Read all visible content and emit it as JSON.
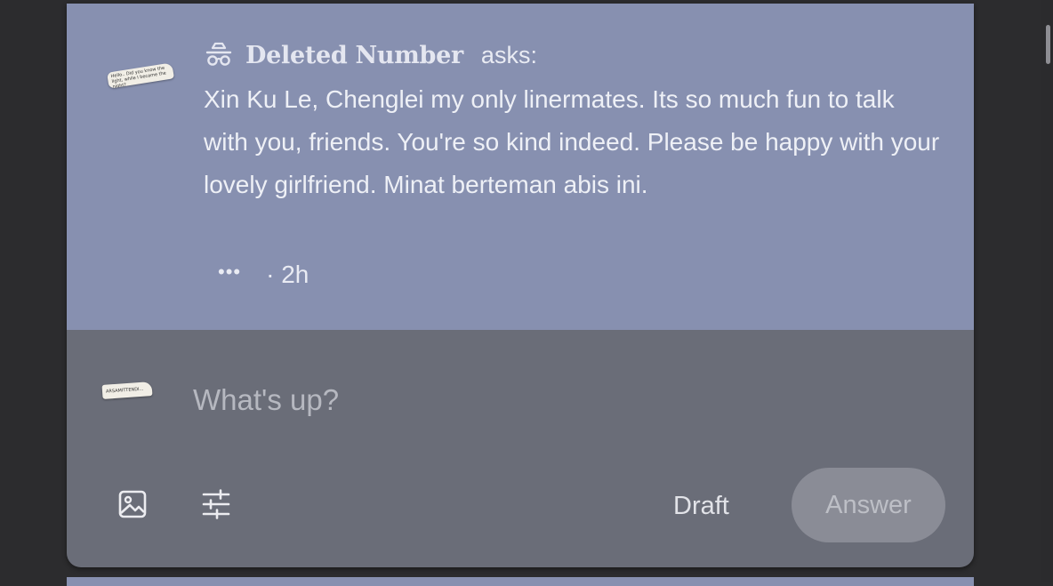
{
  "question": {
    "asker_name": "Deleted Number",
    "asks_label": "asks:",
    "asker_icon": "incognito-icon",
    "asker_avatar_text": "Hello.. Did you know the light, while I became the night?",
    "text": "Xin Ku Le, Chenglei my only linermates. Its so much fun to talk with you, friends. You're so kind indeed. Please be happy with your lovely girlfriend. Minat berteman abis ini.",
    "more_label": "•••",
    "time": "· 2h"
  },
  "answer_box": {
    "avatar_text": "ARSAMITTENDI...",
    "placeholder": "What's up?",
    "value": "",
    "image_icon": "image-icon",
    "settings_icon": "sliders-icon",
    "draft_label": "Draft",
    "answer_label": "Answer"
  },
  "colors": {
    "question_bg": "#8790b0",
    "answer_panel_bg": "#6a6d78",
    "answer_button_bg": "#8a8c96",
    "page_bg": "#2c2c2e"
  }
}
